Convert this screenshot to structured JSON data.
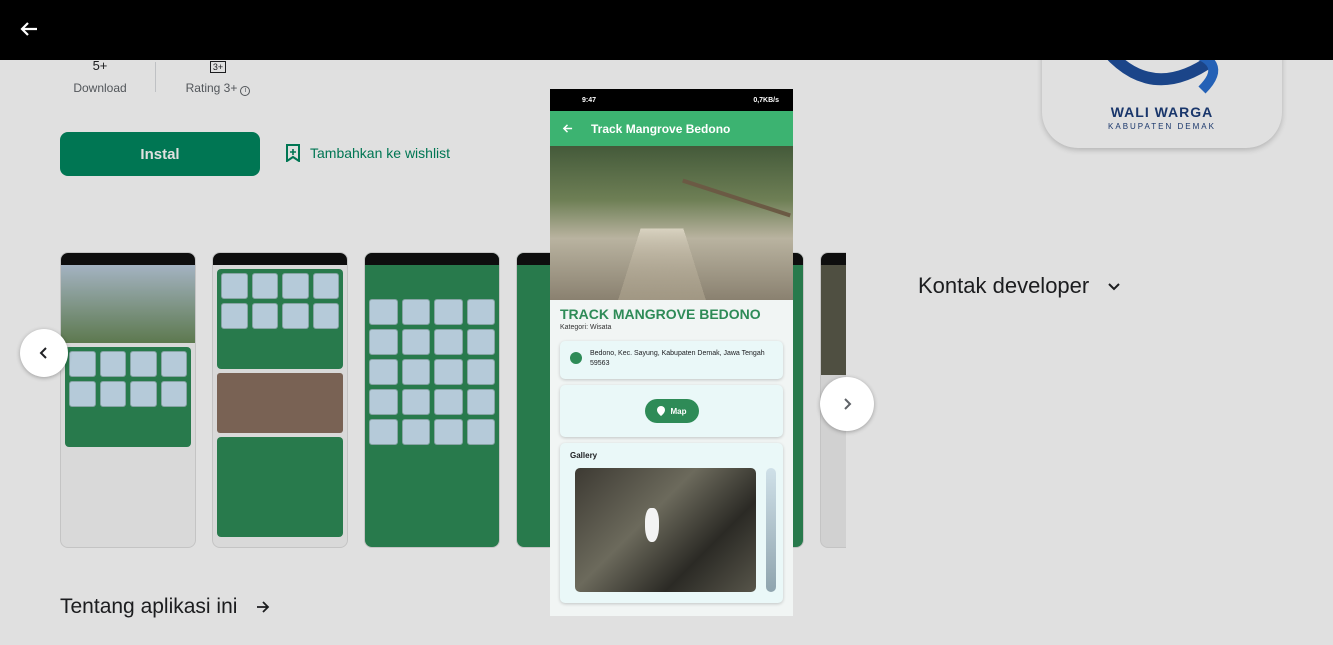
{
  "page": {
    "stats": {
      "downloads_value": "5+",
      "downloads_label": "Download",
      "rating_value": "3+",
      "rating_label": "Rating 3+"
    },
    "install_label": "Instal",
    "wishlist_label": "Tambahkan ke wishlist",
    "logo": {
      "name": "WALI WARGA",
      "sub": "KABUPATEN DEMAK"
    },
    "contact_label": "Kontak developer",
    "about_label": "Tentang aplikasi ini"
  },
  "viewer": {
    "phone": {
      "status_time": "9:47",
      "status_right": "0,7KB/s",
      "appbar_title": "Track Mangrove Bedono",
      "place_name": "TRACK MANGROVE BEDONO",
      "category": "Kategori: Wisata",
      "address": "Bedono, Kec. Sayung, Kabupaten Demak, Jawa Tengah 59563",
      "map_button": "Map",
      "gallery_label": "Gallery"
    }
  },
  "colors": {
    "brand_green": "#01875f",
    "app_green": "#3cb371",
    "title_green": "#2e8b57",
    "overlay": "#000000"
  },
  "icons": [
    "back-arrow-icon",
    "bookmark-icon",
    "chevron-left-icon",
    "chevron-right-icon",
    "chevron-down-icon",
    "arrow-right-icon",
    "location-pin-icon",
    "info-icon"
  ]
}
